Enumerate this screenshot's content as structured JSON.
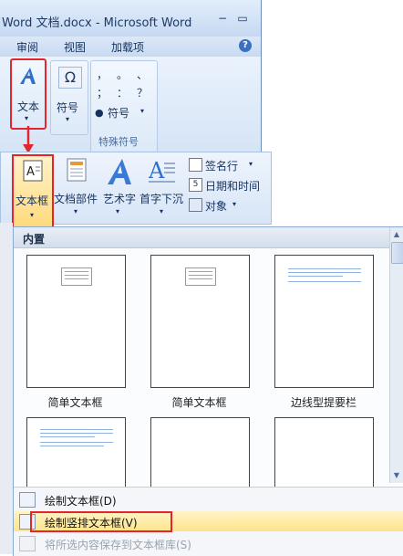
{
  "window": {
    "title": "Word 文档.docx - Microsoft Word",
    "controls": [
      "−",
      "▭"
    ]
  },
  "menubar": {
    "tabs": [
      "审阅",
      "视图",
      "加载项"
    ],
    "help": "?"
  },
  "ribbon": {
    "text_button": "文本",
    "symbol_button": "符号",
    "omega": "Ω",
    "special_symbols": [
      "，",
      "。",
      "、",
      "；",
      "：",
      "？"
    ],
    "symbol_dropdown": "符号",
    "group_label": "特殊符号"
  },
  "strip": {
    "buttons": [
      "文本框",
      "文档部件",
      "艺术字",
      "首字下沉"
    ],
    "side_buttons": [
      "签名行",
      "日期和时间",
      "对象"
    ]
  },
  "panel": {
    "header": "内置",
    "thumbnails": [
      "简单文本框",
      "简单文本框",
      "边线型提要栏",
      "",
      "",
      ""
    ],
    "menu": [
      {
        "label": "绘制文本框(D)"
      },
      {
        "label": "绘制竖排文本框(V)"
      },
      {
        "label": "将所选内容保存到文本框库(S)"
      }
    ]
  },
  "colors": {
    "highlight_red": "#e3262d",
    "ribbon_blue": "#d3e3f7",
    "menu_hover": "#ffe38a"
  }
}
